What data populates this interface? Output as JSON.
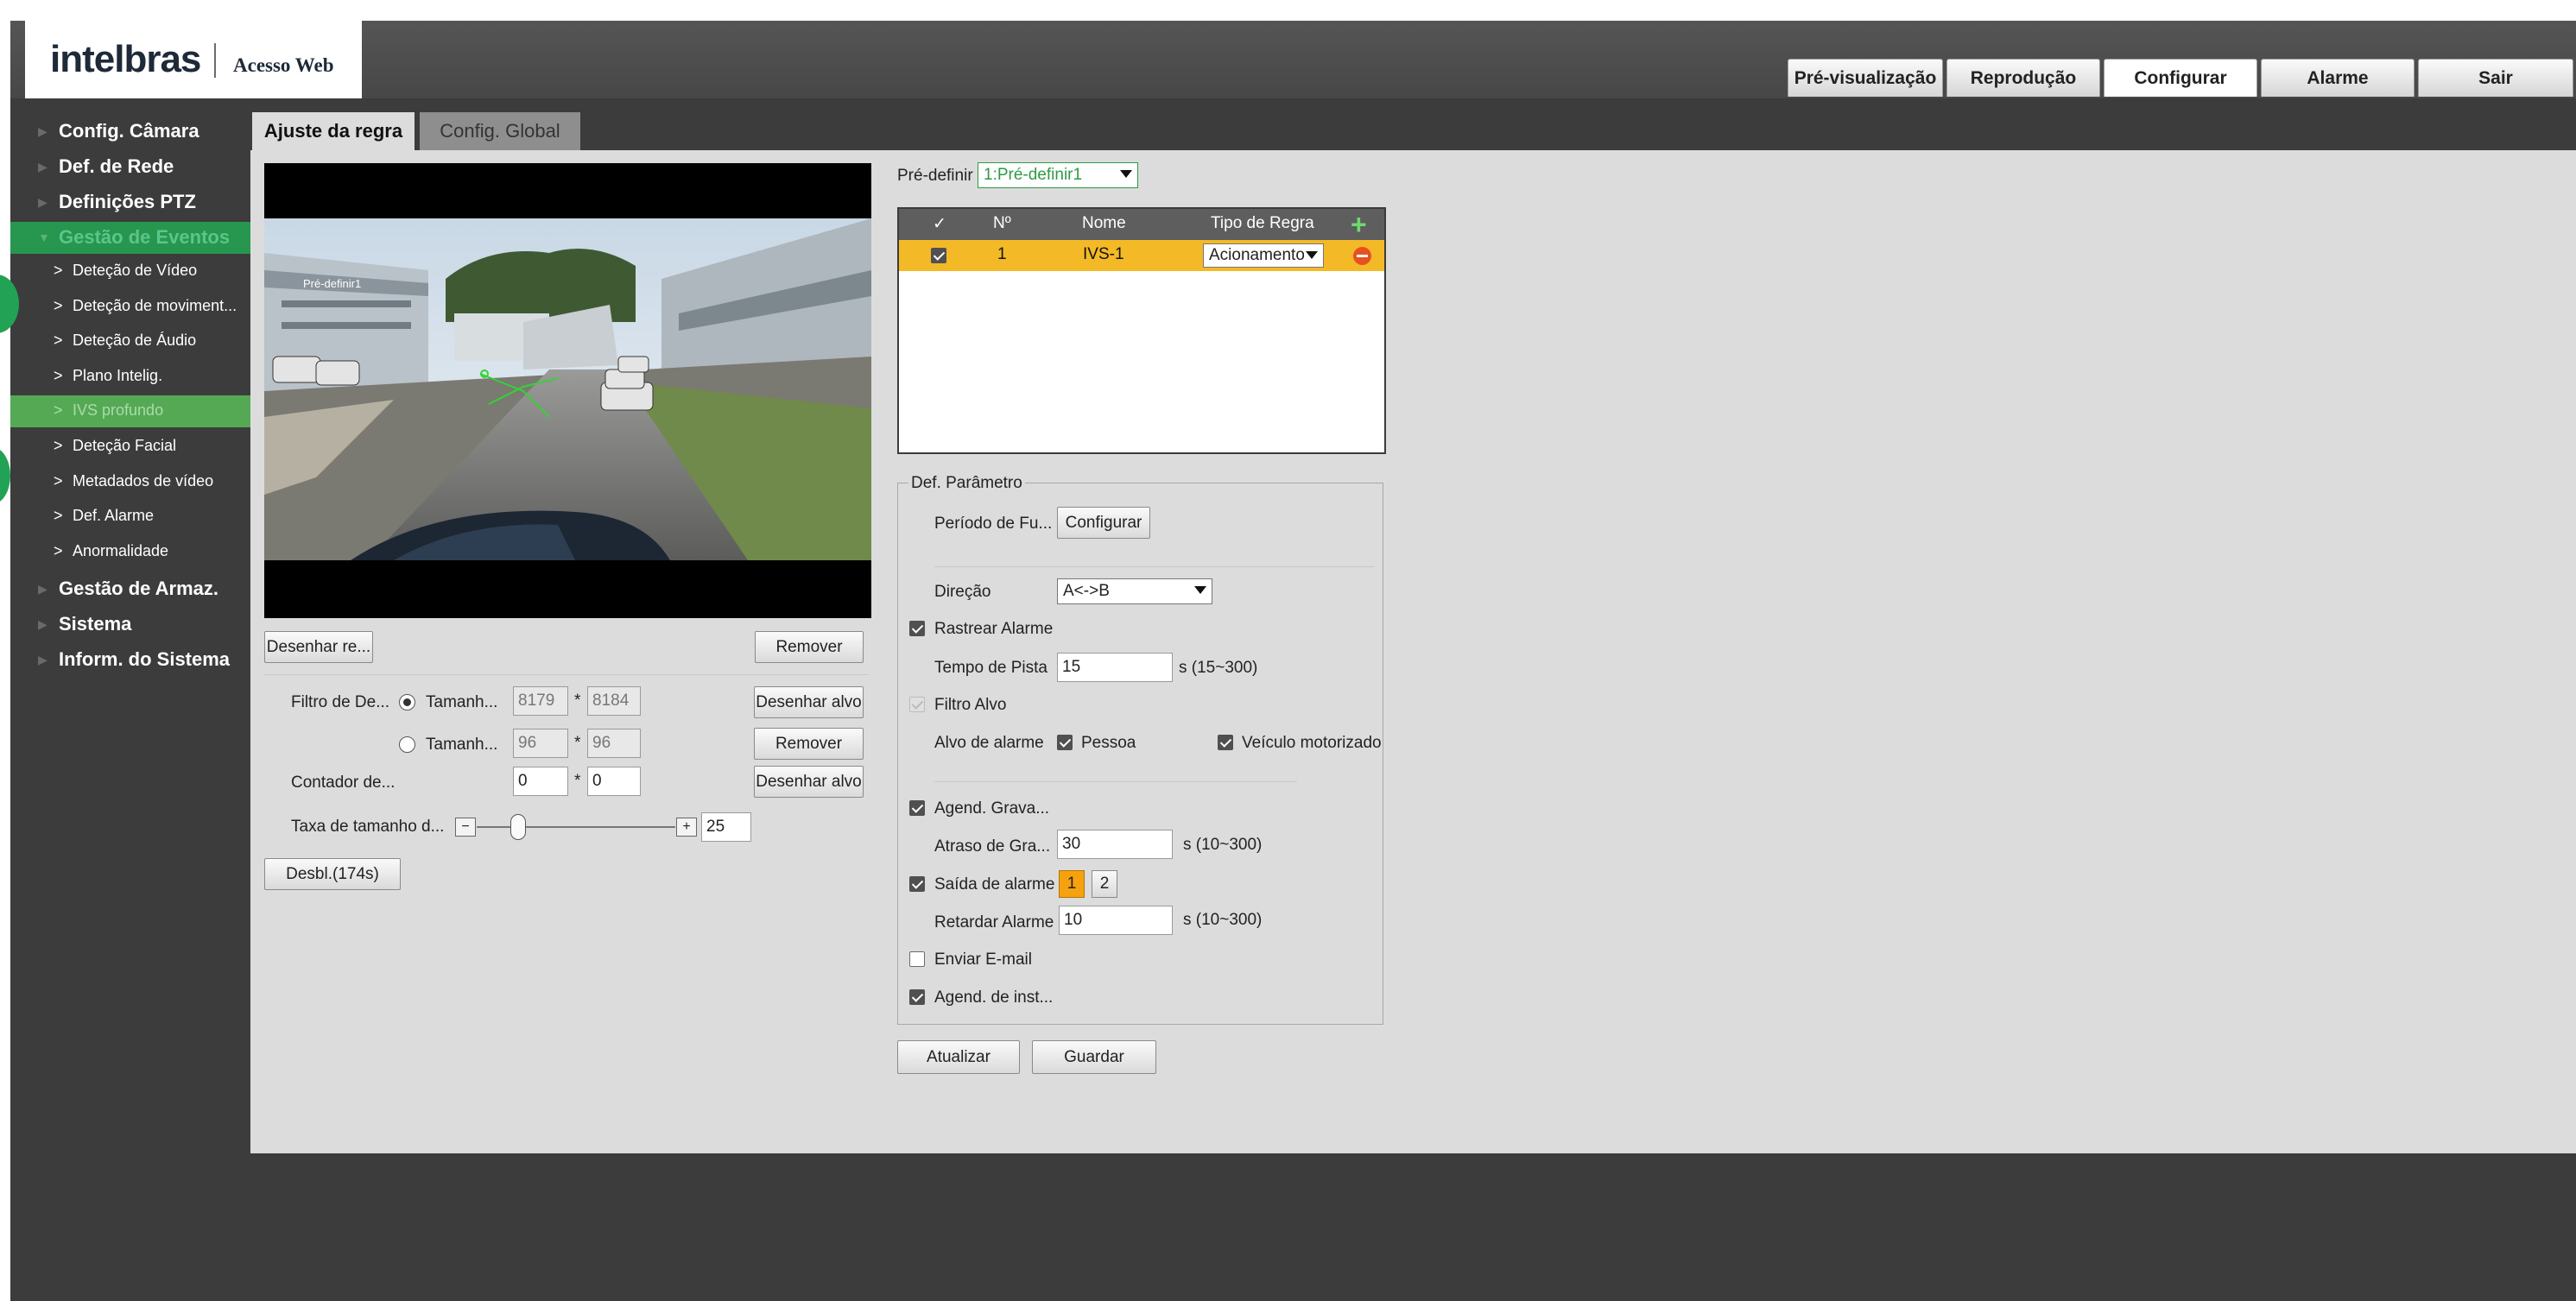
{
  "header": {
    "logo": "intelbras",
    "subtitle": "Acesso Web",
    "tabs": [
      {
        "label": "Pré-visualização"
      },
      {
        "label": "Reprodução"
      },
      {
        "label": "Configurar"
      },
      {
        "label": "Alarme"
      },
      {
        "label": "Sair"
      }
    ]
  },
  "sidebar": {
    "groups": [
      {
        "label": "Config. Câmara"
      },
      {
        "label": "Def. de Rede"
      },
      {
        "label": "Definições PTZ"
      },
      {
        "label": "Gestão de Eventos"
      },
      {
        "label": "Gestão de Armaz."
      },
      {
        "label": "Sistema"
      },
      {
        "label": "Inform. do Sistema"
      }
    ],
    "sub_items": [
      {
        "label": "Deteção de Vídeo"
      },
      {
        "label": "Deteção de moviment..."
      },
      {
        "label": "Deteção de Áudio"
      },
      {
        "label": "Plano Intelig."
      },
      {
        "label": "IVS profundo"
      },
      {
        "label": "Deteção Facial"
      },
      {
        "label": "Metadados de vídeo"
      },
      {
        "label": "Def. Alarme"
      },
      {
        "label": "Anormalidade"
      }
    ],
    "active_group_color": "#27964f",
    "active_item_color": "#55a955"
  },
  "tabs": {
    "rule": "Ajuste da regra",
    "global": "Config. Global"
  },
  "video": {
    "preset_overlay": "Pré-definir1",
    "draw_rule_btn": "Desenhar re...",
    "remove_btn": "Remover"
  },
  "filter": {
    "label": "Filtro de De...",
    "size_label_1": "Tamanh...",
    "w1": "8179",
    "h1": "8184",
    "size_label_2": "Tamanh...",
    "w2": "96",
    "h2": "96",
    "times": "*",
    "draw_target_btn": "Desenhar alvo",
    "remove_btn": "Remover",
    "counter_label": "Contador de...",
    "counter_w": "0",
    "counter_h": "0",
    "draw_target_btn_2": "Desenhar alvo",
    "rate_label": "Taxa de tamanho d...",
    "rate_value": "25",
    "minus": "−",
    "plus": "+",
    "disable_btn": "Desbl.(174s)"
  },
  "preset": {
    "label": "Pré-definir",
    "value": "1:Pré-definir1"
  },
  "rule_table": {
    "headers": [
      "✓",
      "Nº",
      "Nome",
      "Tipo de Regra"
    ],
    "rows": [
      {
        "num": "1",
        "name": "IVS-1",
        "type": "Acionamento"
      }
    ],
    "header_color": "#5e5e5e",
    "selected_row_color": "#f3b927"
  },
  "params": {
    "legend": "Def. Parâmetro",
    "period_label": "Período de Fu...",
    "configure_btn": "Configurar",
    "direction_label": "Direção",
    "direction_value": "A<->B",
    "track_alarm": "Rastrear Alarme",
    "track_time_label": "Tempo de Pista",
    "track_time_value": "15",
    "track_time_unit": "s (15~300)",
    "target_filter": "Filtro Alvo",
    "alarm_target_label": "Alvo de alarme",
    "person": "Pessoa",
    "vehicle": "Veículo motorizado",
    "record_sched": "Agend. Grava...",
    "record_delay_label": "Atraso de Gra...",
    "record_delay_value": "30",
    "record_delay_unit": "s (10~300)",
    "alarm_out": "Saída de alarme",
    "alarm_out_1": "1",
    "alarm_out_2": "2",
    "alarm_delay_label": "Retardar Alarme",
    "alarm_delay_value": "10",
    "alarm_delay_unit": "s (10~300)",
    "send_email": "Enviar E-mail",
    "snapshot_sched": "Agend. de inst..."
  },
  "actions": {
    "refresh": "Atualizar",
    "save": "Guardar"
  }
}
